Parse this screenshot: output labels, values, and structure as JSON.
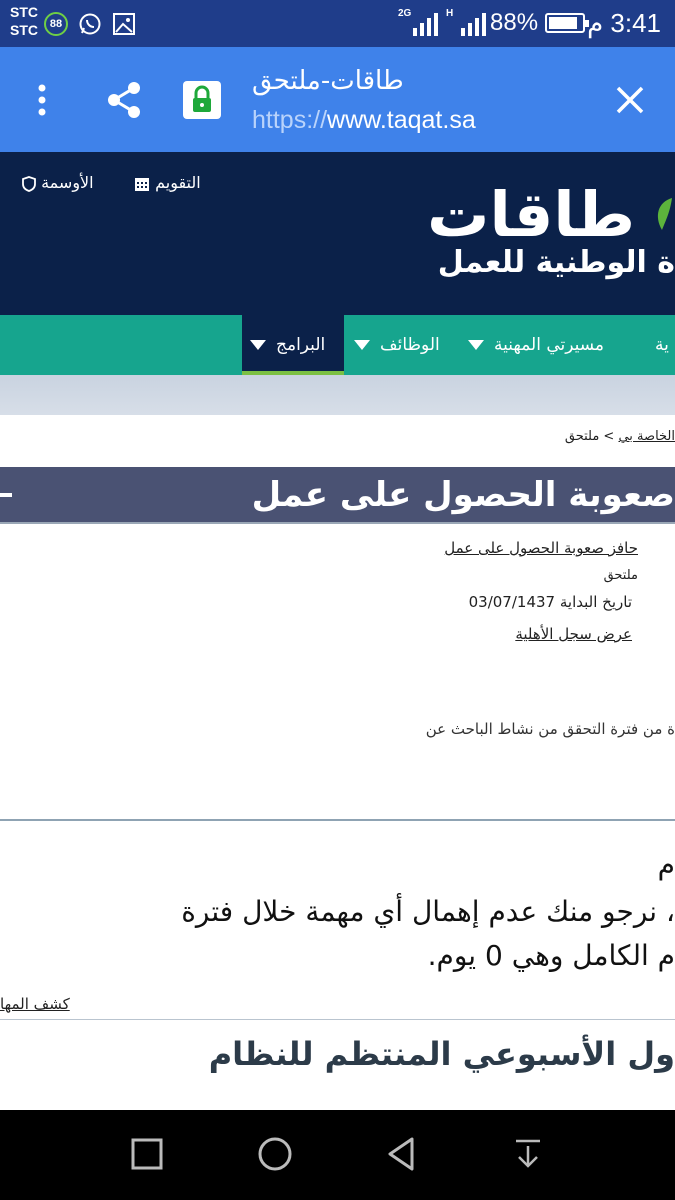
{
  "status_bar": {
    "carrier1": "STC",
    "carrier2": "STC",
    "badge": "88",
    "net1": "2G",
    "net2": "H",
    "battery": "88%",
    "time": "3:41 م"
  },
  "tab_bar": {
    "title": "طاقات-ملتحق",
    "url_proto": "https://",
    "url_host": "www.taqat.sa"
  },
  "header": {
    "awards_label": "الأوسمة",
    "calendar_label": "التقويم",
    "logo_main": "طاقات",
    "logo_sub": "ة الوطنية للعمل"
  },
  "nav": {
    "programs": "البرامج",
    "jobs": "الوظائف",
    "career": "مسيرتي المهنية",
    "partial": "ية"
  },
  "breadcrumb": {
    "link": "الخاصة بي",
    "separator": " > ",
    "current": "ملتحق"
  },
  "title": "صعوبة الحصول على عمل",
  "details": {
    "program_link": "حافز صعوبة الحصول على عمل",
    "status": "ملتحق",
    "start_date": "تاريخ البداية 03/07/1437",
    "eligibility_link": "عرض سجل الأهلية",
    "verify_text": "ة من فترة التحقق من نشاط الباحث عن"
  },
  "notice": {
    "line1": "م",
    "line2": "، نرجو منك عدم إهمال أي مهمة خلال فترة",
    "line3": "م الكامل وهي 0 يوم.",
    "reveal_link": "كشف المها"
  },
  "weekly_title": "ول الأسبوعي المنتظم للنظام",
  "colors": {
    "status_bar": "#1f3d8a",
    "tab_bar": "#3f82ea",
    "header": "#0b2149",
    "nav": "#16a58e",
    "title_band": "#4a5273",
    "accent_green": "#7bc043"
  },
  "icons": [
    "whatsapp-icon",
    "image-icon",
    "menu-icon",
    "share-icon",
    "lock-icon",
    "close-icon",
    "shield-icon",
    "calendar-icon",
    "square-icon",
    "circle-icon",
    "back-icon",
    "download-icon"
  ]
}
